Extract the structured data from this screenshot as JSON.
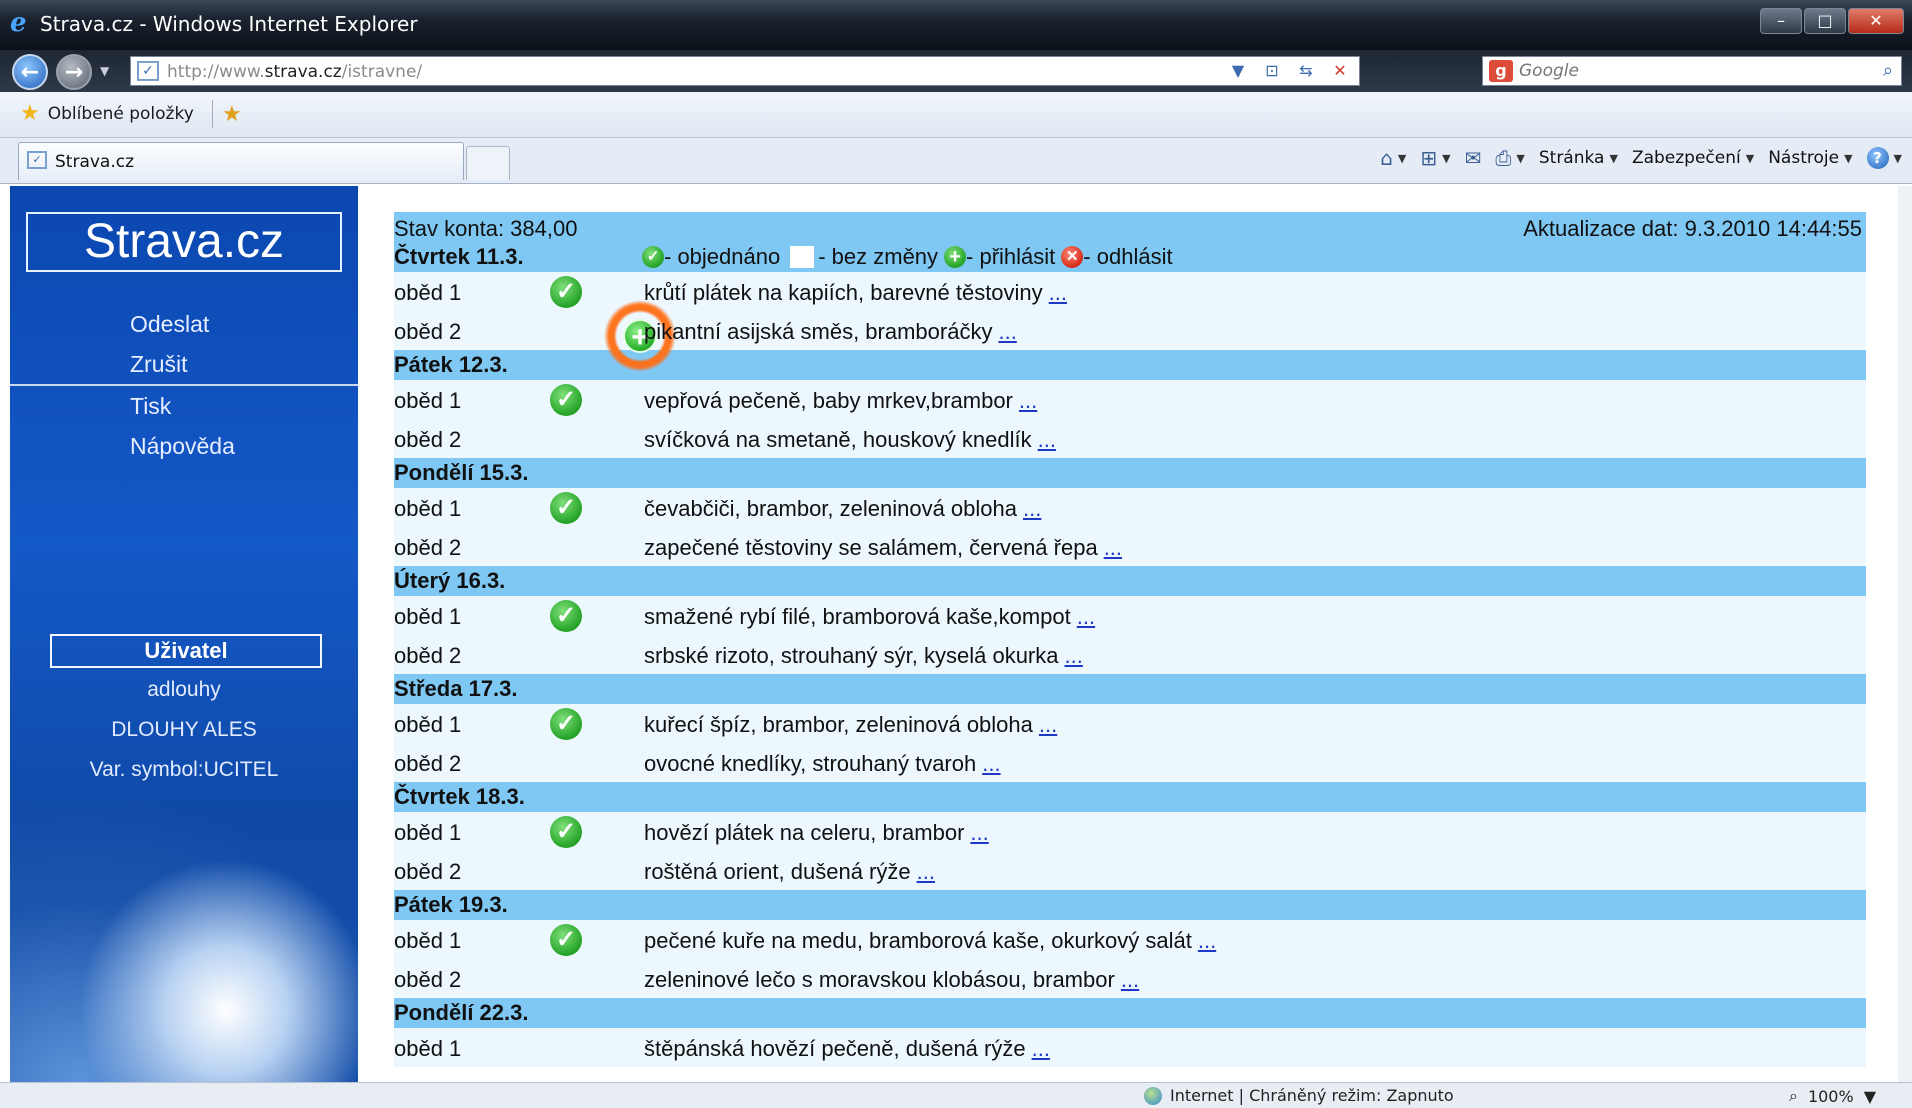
{
  "window": {
    "title": "Strava.cz - Windows Internet Explorer"
  },
  "address_bar": {
    "url_prefix": "http://www.",
    "url_domain": "strava.cz",
    "url_path": "/istravne/"
  },
  "search": {
    "placeholder": "Google"
  },
  "favorites": {
    "label": "Oblíbené položky"
  },
  "tab": {
    "label": "Strava.cz"
  },
  "commands": {
    "page": "Stránka",
    "security": "Zabezpečení",
    "tools": "Nástroje"
  },
  "sidebar": {
    "logo": "Strava.cz",
    "menu": [
      "Odeslat",
      "Zrušit",
      "Tisk",
      "Nápověda"
    ],
    "user_heading": "Uživatel",
    "username": "adlouhy",
    "full_name": "DLOUHY ALES",
    "var_symbol": "Var. symbol:UCITEL"
  },
  "header": {
    "balance": "Stav konta:  384,00",
    "updated": "Aktualizace dat: 9.3.2010 14:44:55",
    "legend_ordered": "- objednáno",
    "legend_nochange": "- bez změny",
    "legend_login": "- přihlásit",
    "legend_logout": "- odhlásit"
  },
  "more_link": "...",
  "days": [
    {
      "name": "Čtvrtek 11.3.",
      "meals": [
        {
          "label": "oběd 1",
          "desc": "krůtí plátek na kapiích, barevné těstoviny",
          "status": "ordered"
        },
        {
          "label": "oběd 2",
          "desc": "pikantní asijská směs, bramboráčky",
          "status": "add"
        }
      ]
    },
    {
      "name": "Pátek 12.3.",
      "meals": [
        {
          "label": "oběd 1",
          "desc": "vepřová pečeně, baby mrkev,brambor",
          "status": "ordered"
        },
        {
          "label": "oběd 2",
          "desc": "svíčková na smetaně, houskový knedlík",
          "status": "none"
        }
      ]
    },
    {
      "name": "Pondělí 15.3.",
      "meals": [
        {
          "label": "oběd 1",
          "desc": "čevabčiči, brambor, zeleninová obloha",
          "status": "ordered"
        },
        {
          "label": "oběd 2",
          "desc": "zapečené těstoviny se salámem, červená řepa",
          "status": "none"
        }
      ]
    },
    {
      "name": "Úterý 16.3.",
      "meals": [
        {
          "label": "oběd 1",
          "desc": "smažené rybí filé, bramborová kaše,kompot",
          "status": "ordered"
        },
        {
          "label": "oběd 2",
          "desc": "srbské rizoto, strouhaný sýr, kyselá okurka",
          "status": "none"
        }
      ]
    },
    {
      "name": "Středa 17.3.",
      "meals": [
        {
          "label": "oběd 1",
          "desc": "kuřecí špíz, brambor, zeleninová obloha",
          "status": "ordered"
        },
        {
          "label": "oběd 2",
          "desc": "ovocné knedlíky, strouhaný tvaroh",
          "status": "none"
        }
      ]
    },
    {
      "name": "Čtvrtek 18.3.",
      "meals": [
        {
          "label": "oběd 1",
          "desc": "hovězí plátek na celeru, brambor",
          "status": "ordered"
        },
        {
          "label": "oběd 2",
          "desc": "roštěná orient, dušená rýže",
          "status": "none"
        }
      ]
    },
    {
      "name": "Pátek 19.3.",
      "meals": [
        {
          "label": "oběd 1",
          "desc": "pečené kuře na medu, bramborová kaše, okurkový salát",
          "status": "ordered"
        },
        {
          "label": "oběd 2",
          "desc": "zeleninové lečo s moravskou klobásou, brambor",
          "status": "none"
        }
      ]
    },
    {
      "name": "Pondělí 22.3.",
      "meals": [
        {
          "label": "oběd 1",
          "desc": "štěpánská hovězí pečeně, dušená rýže",
          "status": "none"
        }
      ]
    }
  ],
  "statusbar": {
    "zone": "Internet | Chráněný režim: Zapnuto",
    "zoom": "100%"
  },
  "colors": {
    "day_header": "#7fc8f4",
    "meal_row": "#ecf8fe",
    "sidebar": "#1459c8",
    "link": "#2038c6"
  }
}
